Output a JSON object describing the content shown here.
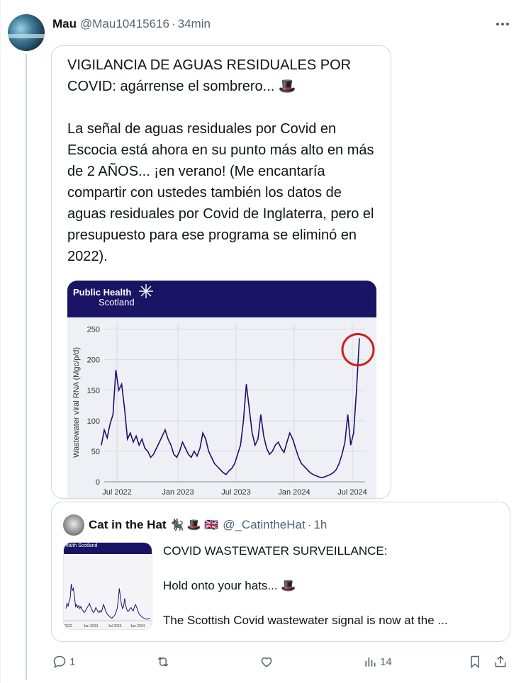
{
  "post": {
    "author_name": "Mau",
    "author_handle": "@Mau10415616",
    "separator": "·",
    "time": "34min"
  },
  "quote1": {
    "paragraphs": [
      "VIGILANCIA DE AGUAS RESIDUALES POR COVID: agárrense el sombrero... 🎩",
      "La señal de aguas residuales por Covid en Escocia está ahora en su punto más alto en más de 2 AÑOS... ¡en verano! (Me encantaría compartir con ustedes también los datos de aguas residuales por Covid de Inglaterra, pero el presupuesto para ese programa se eliminó en 2022)."
    ],
    "image": {
      "logo_line1": "Public Health",
      "logo_line2": "Scotland",
      "chart_data": {
        "type": "line",
        "ylabel": "Wastewater viral RNA (Mgc/p/d)",
        "ylim": [
          0,
          260
        ],
        "yticks": [
          "0",
          "50",
          "100",
          "150",
          "200",
          "250"
        ],
        "xticks": [
          "Jul 2022",
          "Jan 2023",
          "Jul 2023",
          "Jan 2024",
          "Jul 2024"
        ],
        "series": [
          {
            "values": [
              60,
              85,
              72,
              95,
              110,
              183,
              150,
              160,
              120,
              70,
              80,
              65,
              75,
              60,
              70,
              55,
              50,
              40,
              45,
              55,
              65,
              75,
              85,
              70,
              60,
              45,
              40,
              50,
              65,
              55,
              45,
              40,
              50,
              42,
              55,
              80,
              70,
              50,
              40,
              30,
              25,
              20,
              15,
              12,
              18,
              22,
              30,
              45,
              60,
              100,
              160,
              120,
              80,
              60,
              70,
              110,
              75,
              55,
              45,
              50,
              60,
              65,
              55,
              48,
              65,
              80,
              70,
              55,
              40,
              30,
              25,
              20,
              15,
              12,
              10,
              8,
              7,
              8,
              10,
              12,
              15,
              20,
              30,
              45,
              65,
              110,
              60,
              80,
              150,
              235
            ]
          }
        ],
        "annotation": "red circle around latest peak"
      }
    }
  },
  "quote2": {
    "author_name": "Cat in the Hat",
    "author_emojis": "🐈‍⬛ 🎩 🇬🇧",
    "author_handle": "@_CatintheHat",
    "separator": "·",
    "time": "1h",
    "thumb_logo": "ealth Scotland",
    "thumb_xticks": [
      "2022",
      "Jan 2023",
      "Jul 2023",
      "Jan 2024"
    ],
    "lines": [
      "COVID WASTEWATER SURVEILLANCE:",
      "Hold onto your hats... 🎩",
      "The Scottish Covid wastewater signal is now at the ..."
    ]
  },
  "actions": {
    "reply_count": "1",
    "repost_count": "",
    "like_count": "",
    "views_count": "14"
  }
}
